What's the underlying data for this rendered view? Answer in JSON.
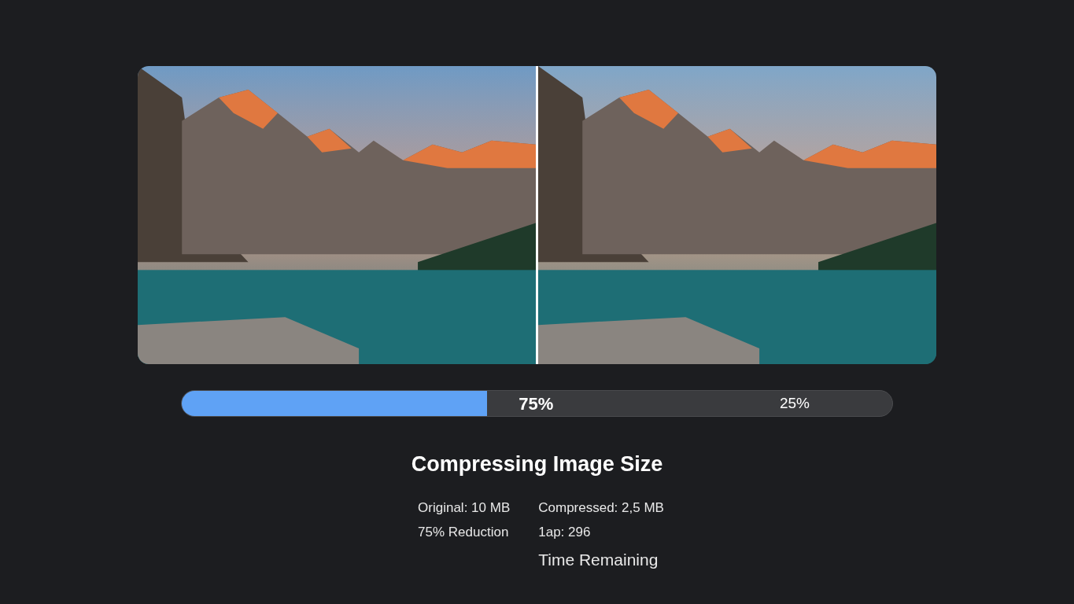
{
  "comparison": {
    "images": [
      {
        "kind": "original"
      },
      {
        "kind": "compressed"
      }
    ]
  },
  "progress": {
    "level": 0.43,
    "done_label": "75%",
    "remaining_label": "25%"
  },
  "title": "Compressing Image Size",
  "stats": {
    "left": [
      "Original: 10 MB",
      "75% Reduction"
    ],
    "right": [
      "Compressed: 2,5 MB",
      "1ap: 296",
      "Time Remaining"
    ]
  }
}
